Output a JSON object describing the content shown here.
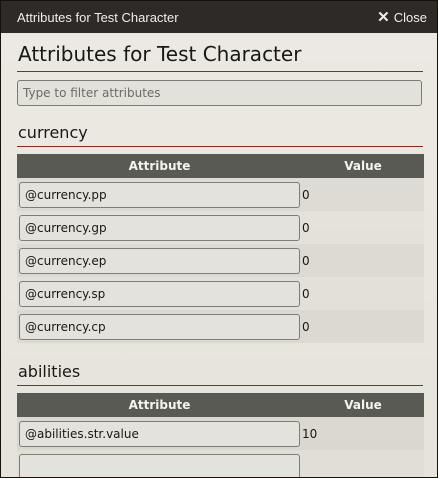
{
  "window": {
    "title": "Attributes for Test Character",
    "close_label": "Close"
  },
  "main": {
    "heading": "Attributes for Test Character",
    "filter_placeholder": "Type to filter attributes"
  },
  "columns": {
    "attribute": "Attribute",
    "value": "Value"
  },
  "sections": [
    {
      "title": "currency",
      "rows": [
        {
          "key": "@currency.pp",
          "value": "0"
        },
        {
          "key": "@currency.gp",
          "value": "0"
        },
        {
          "key": "@currency.ep",
          "value": "0"
        },
        {
          "key": "@currency.sp",
          "value": "0"
        },
        {
          "key": "@currency.cp",
          "value": "0"
        }
      ]
    },
    {
      "title": "abilities",
      "rows": [
        {
          "key": "@abilities.str.value",
          "value": "10"
        }
      ]
    }
  ]
}
